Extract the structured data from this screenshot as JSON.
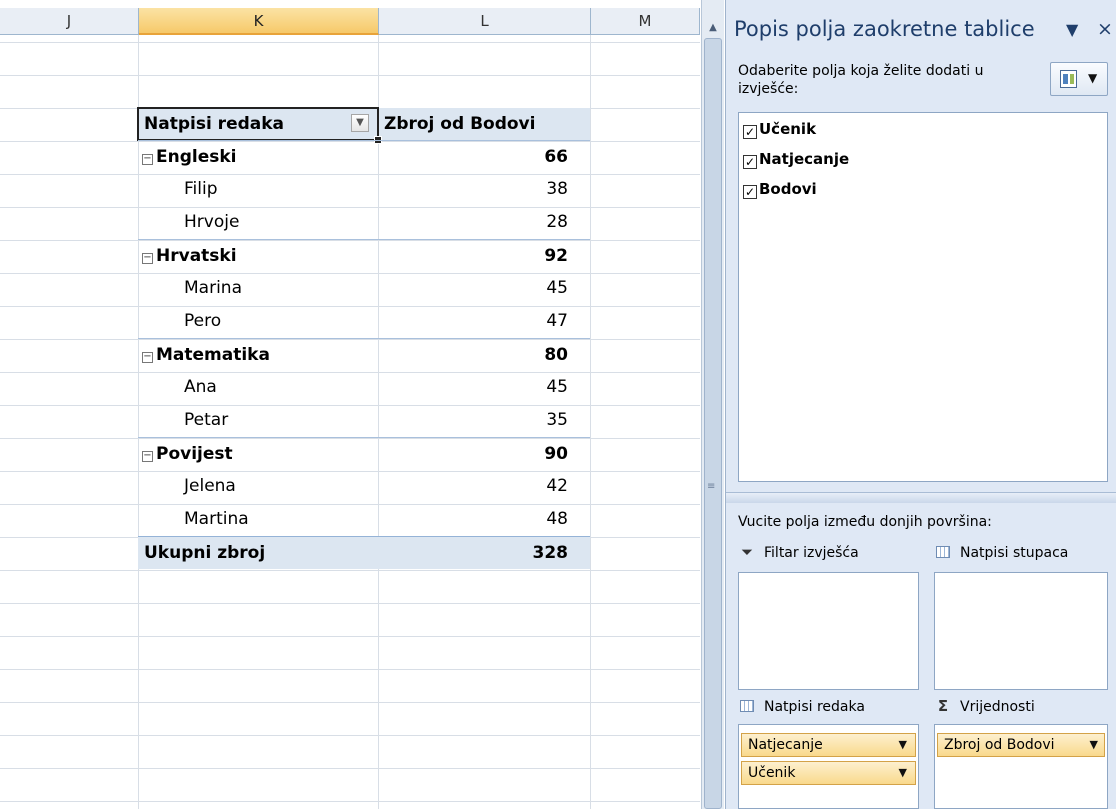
{
  "columns": [
    "J",
    "K",
    "L",
    "M"
  ],
  "pivot": {
    "header_rows": "Natpisi redaka",
    "header_values": "Zbroj od Bodovi",
    "groups": [
      {
        "name": "Engleski",
        "total": "66",
        "items": [
          {
            "name": "Filip",
            "value": "38"
          },
          {
            "name": "Hrvoje",
            "value": "28"
          }
        ]
      },
      {
        "name": "Hrvatski",
        "total": "92",
        "items": [
          {
            "name": "Marina",
            "value": "45"
          },
          {
            "name": "Pero",
            "value": "47"
          }
        ]
      },
      {
        "name": "Matematika",
        "total": "80",
        "items": [
          {
            "name": "Ana",
            "value": "45"
          },
          {
            "name": "Petar",
            "value": "35"
          }
        ]
      },
      {
        "name": "Povijest",
        "total": "90",
        "items": [
          {
            "name": "Jelena",
            "value": "42"
          },
          {
            "name": "Martina",
            "value": "48"
          }
        ]
      }
    ],
    "grand_total_label": "Ukupni zbroj",
    "grand_total_value": "328"
  },
  "pane": {
    "title": "Popis polja zaokretne tablice",
    "choose_fields_text": "Odaberite polja koja želite dodati u izvješće:",
    "fields": [
      {
        "label": "Učenik",
        "checked": true
      },
      {
        "label": "Natjecanje",
        "checked": true
      },
      {
        "label": "Bodovi",
        "checked": true
      }
    ],
    "drag_text": "Vucite polja između donjih površina:",
    "areas": {
      "report_filter": "Filtar izvješća",
      "column_labels": "Natpisi stupaca",
      "row_labels": "Natpisi redaka",
      "values": "Vrijednosti"
    },
    "row_fields": [
      "Natjecanje",
      "Učenik"
    ],
    "value_fields": [
      "Zbroj od Bodovi"
    ]
  }
}
